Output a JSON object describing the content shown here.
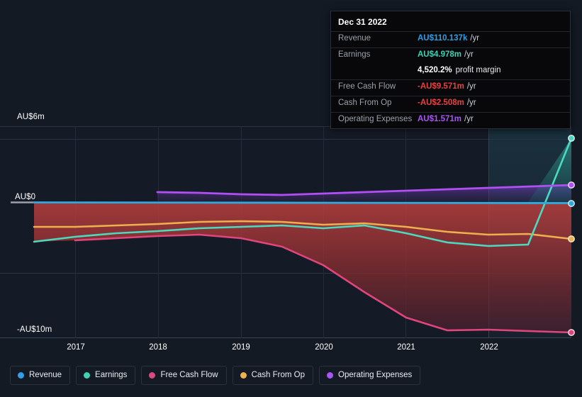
{
  "chart_data": {
    "type": "line",
    "title": "",
    "xlabel": "",
    "ylabel": "",
    "currency": "AU$",
    "x_ticks": [
      "2017",
      "2018",
      "2019",
      "2020",
      "2021",
      "2022"
    ],
    "y_ticks": [
      "AU$6m",
      "AU$0",
      "-AU$10m"
    ],
    "ylim": [
      -10000000,
      6000000
    ],
    "grid": true,
    "legend_position": "bottom",
    "highlight_band": {
      "from": "2022",
      "label": "forecast-region"
    },
    "series": [
      {
        "name": "Revenue",
        "color": "#2eaae0",
        "end_value": "AU$110.137k",
        "values": [
          0.11,
          0.11,
          0.11,
          0.11,
          0.11,
          0.11,
          0.11,
          0.11,
          0.11,
          0.11,
          0.11,
          0.11,
          0.11,
          0.11,
          0.11,
          0.11,
          0.11
        ]
      },
      {
        "name": "Earnings",
        "color": "#4cd9c0",
        "end_value": "AU$4.978m",
        "values": [
          -2.95,
          -2.45,
          -2.0,
          -1.72,
          -1.5,
          -1.42,
          -1.3,
          -1.42,
          -1.28,
          -1.4,
          -1.86,
          -2.38,
          -2.1,
          -1.75,
          -2.25,
          -2.3,
          4.978
        ]
      },
      {
        "name": "Free Cash Flow",
        "color": "#e0457b",
        "color_label": "#d94a7e",
        "end_value": "-AU$9.571m",
        "values": [
          -1.55,
          -1.5,
          -1.3,
          -1.2,
          -1.12,
          -1.22,
          -1.72,
          -2.1,
          -2.1,
          -1.78,
          -2.4,
          -3.8,
          -6.5,
          -9.1,
          -9.85,
          -9.7,
          -9.571
        ]
      },
      {
        "name": "Cash From Op",
        "color": "#eeb04e",
        "end_value": "-AU$2.508m",
        "values": [
          -1.22,
          -1.2,
          -1.12,
          -0.98,
          -0.9,
          -0.9,
          -0.95,
          -1.12,
          -1.04,
          -1.14,
          -1.26,
          -1.5,
          -1.75,
          -1.95,
          -2.02,
          -2.2,
          -2.508
        ]
      },
      {
        "name": "Operating Expenses",
        "color": "#b14ff5",
        "color_label": "#a855f7",
        "end_value": "AU$1.571m",
        "values": [
          null,
          null,
          0.75,
          0.7,
          0.62,
          0.6,
          0.64,
          0.7,
          0.78,
          0.86,
          0.96,
          1.06,
          1.14,
          1.22,
          1.32,
          1.44,
          1.571
        ]
      }
    ]
  },
  "tooltip": {
    "date": "Dec 31 2022",
    "unit_suffix": "/yr",
    "rows": [
      {
        "key": "Revenue",
        "value": "AU$110.137k",
        "unit": "/yr",
        "color": "#2f9fe8"
      },
      {
        "key": "Earnings",
        "value": "AU$4.978m",
        "unit": "/yr",
        "color": "#3fd0b5"
      },
      {
        "key": "",
        "value": "4,520.2%",
        "sub": "profit margin",
        "color": "#ffffff"
      },
      {
        "key": "Free Cash Flow",
        "value": "-AU$9.571m",
        "unit": "/yr",
        "color": "#e8413f"
      },
      {
        "key": "Cash From Op",
        "value": "-AU$2.508m",
        "unit": "/yr",
        "color": "#e8413f"
      },
      {
        "key": "Operating Expenses",
        "value": "AU$1.571m",
        "unit": "/yr",
        "color": "#a855f7"
      }
    ]
  },
  "axis": {
    "y_top": "AU$6m",
    "y_zero": "AU$0",
    "y_bottom": "-AU$10m",
    "x": [
      "2017",
      "2018",
      "2019",
      "2020",
      "2021",
      "2022"
    ]
  },
  "legend": {
    "items": [
      {
        "label": "Revenue",
        "color": "#2f9fe8"
      },
      {
        "label": "Earnings",
        "color": "#3fd0b5"
      },
      {
        "label": "Free Cash Flow",
        "color": "#d94a7e"
      },
      {
        "label": "Cash From Op",
        "color": "#eeb04e"
      },
      {
        "label": "Operating Expenses",
        "color": "#a855f7"
      }
    ]
  }
}
